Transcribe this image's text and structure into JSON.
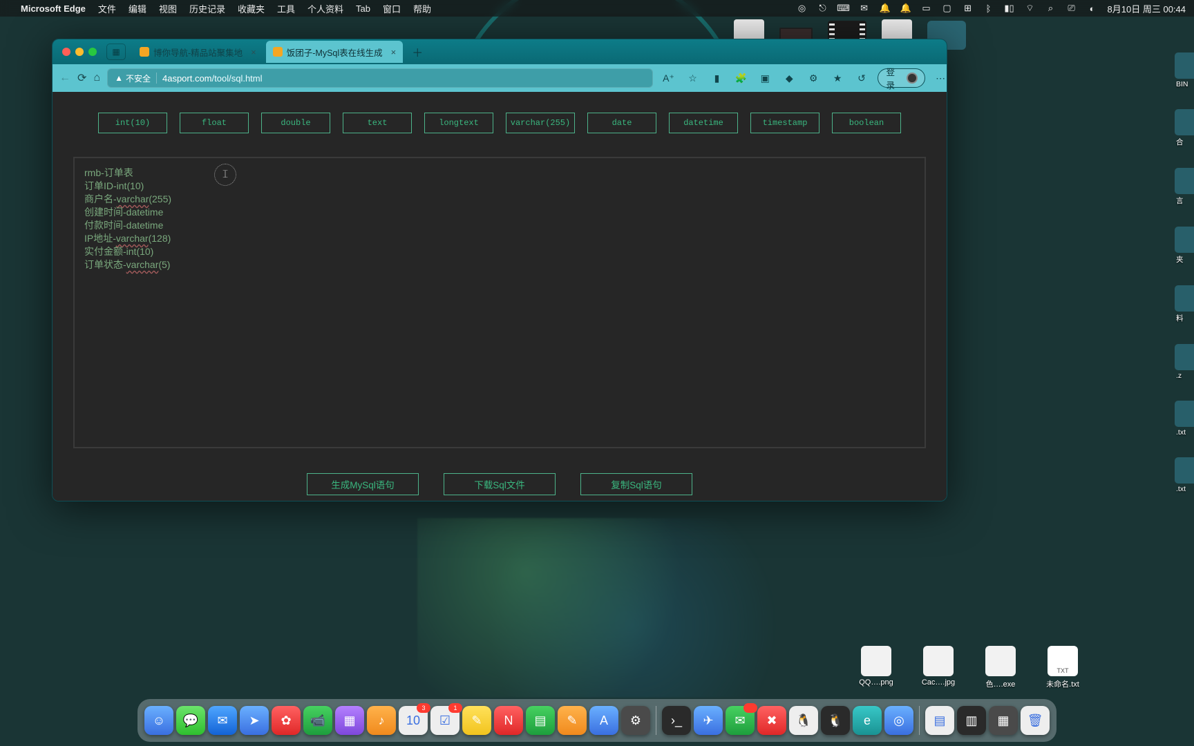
{
  "menubar": {
    "apple": "",
    "app": "Microsoft Edge",
    "items": [
      "文件",
      "编辑",
      "视图",
      "历史记录",
      "收藏夹",
      "工具",
      "个人资料",
      "Tab",
      "窗口",
      "帮助"
    ],
    "clock": "8月10日 周三  00:44"
  },
  "browser": {
    "tabs": [
      {
        "title": "博你导航-精品站聚集地",
        "active": false
      },
      {
        "title": "饭团子-MySql表在线生成",
        "active": true
      }
    ],
    "addressbar": {
      "insecure_label": "不安全",
      "host": "4asport.com",
      "path": "/tool/sql.html"
    },
    "login_label": "登录"
  },
  "page": {
    "type_buttons": [
      "int(10)",
      "float",
      "double",
      "text",
      "longtext",
      "varchar(255)",
      "date",
      "datetime",
      "timestamp",
      "boolean"
    ],
    "editor_lines": [
      {
        "text": "rmb-订单表"
      },
      {
        "text": "订单ID-int(10)"
      },
      {
        "text": "商户名-varchar(255)",
        "underline_word": "varchar"
      },
      {
        "text": "创建时间-datetime"
      },
      {
        "text": "付款时间-datetime"
      },
      {
        "text": "IP地址-varchar(128)",
        "underline_word": "varchar"
      },
      {
        "text": "实付金额-int(10)"
      },
      {
        "text": "订单状态-varchar(5)",
        "underline_word": "varchar"
      }
    ],
    "action_buttons": [
      "生成MySql语句",
      "下载Sql文件",
      "复制Sql语句"
    ]
  },
  "desktop": {
    "right_edge_labels": [
      "BIN",
      "合",
      "言",
      "夹",
      "料",
      ".z",
      ".txt",
      ".txt"
    ],
    "lower_files": [
      "QQ….png",
      "Cac….jpg",
      "色….exe",
      "未命名.txt"
    ]
  }
}
